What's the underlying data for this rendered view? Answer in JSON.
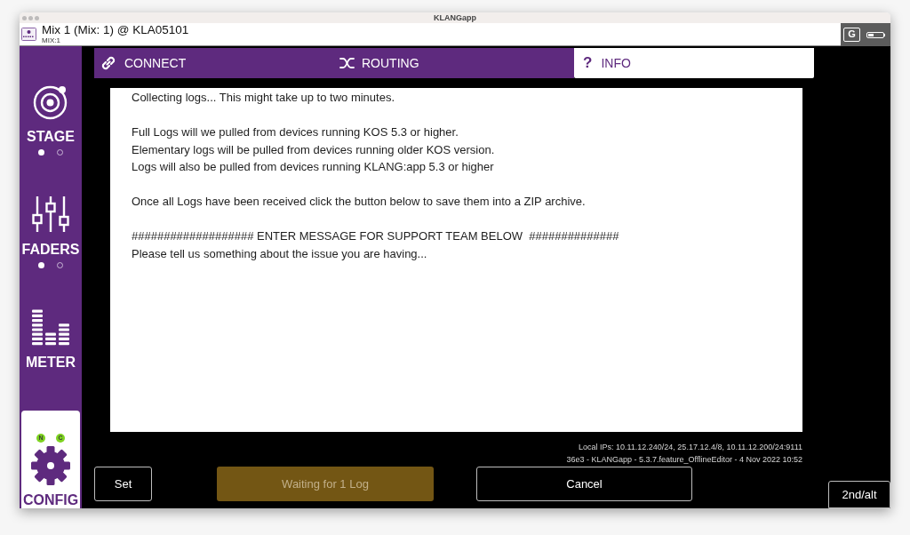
{
  "window": {
    "title": "KLANGapp"
  },
  "header": {
    "title": "Mix 1 (Mix: 1) @ KLA05101",
    "subtitle": "MIX:1",
    "logo_letter": "G"
  },
  "sidebar": {
    "items": [
      {
        "label": "STAGE",
        "selected": false,
        "pages": [
          {
            "selected": true
          },
          {
            "selected": false
          }
        ]
      },
      {
        "label": "FADERS",
        "selected": false,
        "pages": [
          {
            "selected": true
          },
          {
            "selected": false
          }
        ]
      },
      {
        "label": "METER",
        "selected": false
      },
      {
        "label": "CONFIG",
        "selected": true,
        "badges": [
          "N",
          "C"
        ]
      }
    ]
  },
  "tabs": [
    {
      "label": "CONNECT",
      "selected": false
    },
    {
      "label": "ROUTING",
      "selected": false
    },
    {
      "label": "INFO",
      "selected": true,
      "glyph": "?"
    }
  ],
  "message_field": {
    "paragraphs": [
      [
        "Collecting logs... This might take up to two minutes."
      ],
      [
        "Full Logs will we pulled from devices running KOS 5.3 or higher.",
        "Elementary logs will be pulled from devices running older KOS version.",
        "Logs will also be pulled from devices running KLANG:app 5.3 or higher"
      ],
      [
        "Once all Logs have been received click the button below to save them into a ZIP archive."
      ],
      [
        "################### ENTER MESSAGE FOR SUPPORT TEAM BELOW  ##############",
        "Please tell us something about the issue you are having..."
      ]
    ]
  },
  "footer": {
    "lines": [
      "Local IPs: 10.11.12.240/24, 25.17.12.4/8, 10.11.12.200/24:9111",
      "36e3 - KLANGapp - 5.3.7.feature_OfflineEditor - 4 Nov 2022 10:52"
    ]
  },
  "buttons": [
    {
      "label": "Set",
      "kind": "outline",
      "disabled": false
    },
    {
      "label": "Waiting for 1 Log",
      "kind": "filled",
      "disabled": true
    },
    {
      "label": "Cancel",
      "kind": "outline",
      "disabled": false
    }
  ],
  "alt_button": {
    "label": "2nd/alt"
  }
}
